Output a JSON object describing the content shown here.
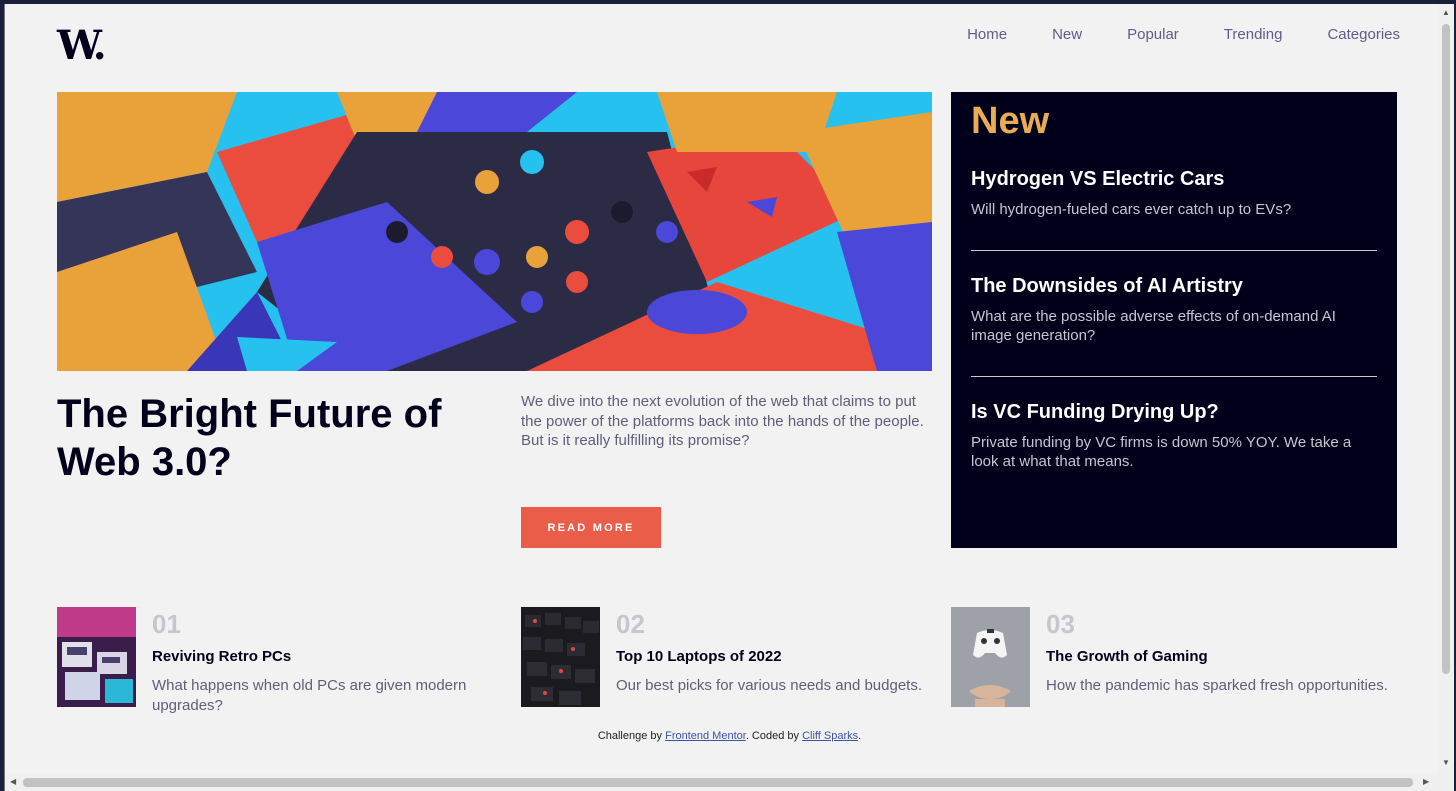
{
  "header": {
    "logo": "W.",
    "nav": [
      "Home",
      "New",
      "Popular",
      "Trending",
      "Categories"
    ]
  },
  "hero": {
    "image_alt": "colorful 3D blocks",
    "title": "The Bright Future of Web 3.0?",
    "description": "We dive into the next evolution of the web that claims to put the power of the platforms back into the hands of the people. But is it really fulfilling its promise?",
    "button_label": "READ MORE"
  },
  "new_panel": {
    "title": "New",
    "items": [
      {
        "title": "Hydrogen VS Electric Cars",
        "text": "Will hydrogen-fueled cars ever catch up to EVs?"
      },
      {
        "title": "The Downsides of AI Artistry",
        "text": "What are the possible adverse effects of on-demand AI image generation?"
      },
      {
        "title": "Is VC Funding Drying Up?",
        "text": "Private funding by VC firms is down 50% YOY. We take a look at what that means."
      }
    ]
  },
  "articles": [
    {
      "num": "01",
      "title": "Reviving Retro PCs",
      "text": "What happens when old PCs are given modern upgrades?"
    },
    {
      "num": "02",
      "title": "Top 10 Laptops of 2022",
      "text": "Our best picks for various needs and budgets."
    },
    {
      "num": "03",
      "title": "The Growth of Gaming",
      "text": "How the pandemic has sparked fresh opportunities."
    }
  ],
  "footer": {
    "prefix": "Challenge by ",
    "link1": "Frontend Mentor",
    "middle": ". Coded by ",
    "link2": "Cliff Sparks",
    "suffix": "."
  },
  "colors": {
    "accent_red": "#ea5e49",
    "accent_orange": "#e9ab53",
    "dark": "#00001a",
    "grayish_blue": "#5d5f79"
  }
}
